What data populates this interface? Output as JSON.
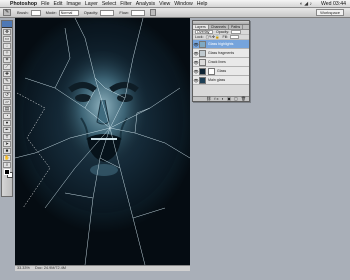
{
  "menubar": {
    "apple": "",
    "app": "Photoshop",
    "items": [
      "File",
      "Edit",
      "Image",
      "Layer",
      "Select",
      "Filter",
      "Analysis",
      "View",
      "Window",
      "Help"
    ],
    "clock": "Wed 03:44"
  },
  "options": {
    "brush_label": "Brush:",
    "mode_label": "Mode:",
    "mode_value": "Normal",
    "opacity_label": "Opacity:",
    "flow_label": "Flow:",
    "workspace": "Workspace"
  },
  "layers_panel": {
    "tabs": [
      "Layers",
      "Channels",
      "Paths"
    ],
    "blend": "Overlay",
    "opacity_label": "Opacity:",
    "lock_label": "Lock:",
    "fill_label": "Fill:",
    "layers": [
      {
        "name": "Glass highlights",
        "thumb": "#7fa9c2",
        "selected": true
      },
      {
        "name": "Glass fragments",
        "thumb": "#bfc9cf",
        "selected": false
      },
      {
        "name": "Crack lines",
        "thumb": "#dcdcdc",
        "selected": false
      },
      {
        "name": "Glass",
        "thumb": "#0e2434",
        "selected": false,
        "mask": true
      },
      {
        "name": "Main glass",
        "thumb": "#1d3f55",
        "selected": false
      }
    ]
  },
  "status": {
    "zoom": "33.33%",
    "doc": "Doc: 24.9M/72.4M"
  },
  "colors": {
    "canvas_bg": "#0c1c26",
    "selection": "#76a4dc"
  }
}
